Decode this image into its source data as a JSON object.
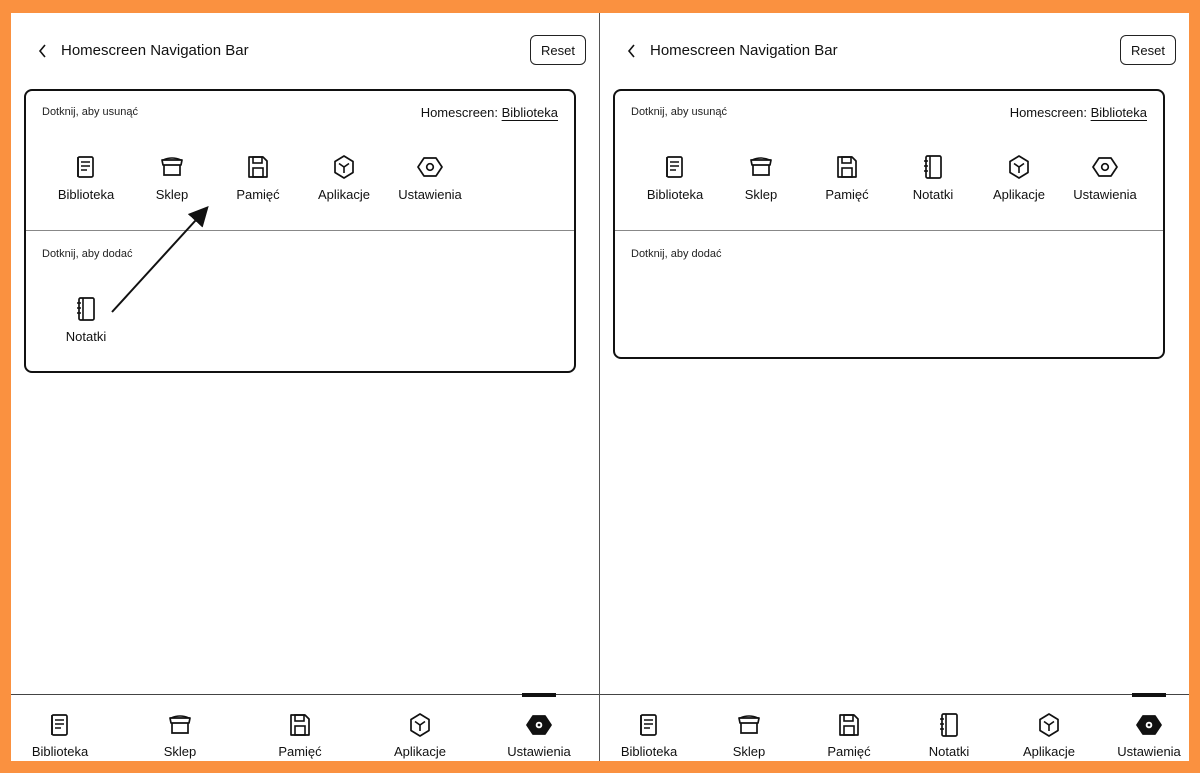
{
  "left": {
    "header": {
      "title": "Homescreen Navigation Bar",
      "reset_label": "Reset"
    },
    "card": {
      "remove_label": "Dotknij, aby usunąć",
      "homescreen_prefix": "Homescreen:",
      "homescreen_value": "Biblioteka",
      "active_items": [
        {
          "label": "Biblioteka",
          "icon": "book-icon"
        },
        {
          "label": "Sklep",
          "icon": "store-icon"
        },
        {
          "label": "Pamięć",
          "icon": "save-icon"
        },
        {
          "label": "Aplikacje",
          "icon": "cube-icon"
        },
        {
          "label": "Ustawienia",
          "icon": "settings-icon"
        }
      ],
      "add_label": "Dotknij, aby dodać",
      "available_items": [
        {
          "label": "Notatki",
          "icon": "notebook-icon"
        }
      ]
    },
    "tabs": [
      {
        "label": "Biblioteka",
        "icon": "book-icon"
      },
      {
        "label": "Sklep",
        "icon": "store-icon"
      },
      {
        "label": "Pamięć",
        "icon": "save-icon"
      },
      {
        "label": "Aplikacje",
        "icon": "cube-icon"
      },
      {
        "label": "Ustawienia",
        "icon": "settings-icon",
        "active": true
      }
    ]
  },
  "right": {
    "header": {
      "title": "Homescreen Navigation Bar",
      "reset_label": "Reset"
    },
    "card": {
      "remove_label": "Dotknij, aby usunąć",
      "homescreen_prefix": "Homescreen:",
      "homescreen_value": "Biblioteka",
      "active_items": [
        {
          "label": "Biblioteka",
          "icon": "book-icon"
        },
        {
          "label": "Sklep",
          "icon": "store-icon"
        },
        {
          "label": "Pamięć",
          "icon": "save-icon"
        },
        {
          "label": "Notatki",
          "icon": "notebook-icon"
        },
        {
          "label": "Aplikacje",
          "icon": "cube-icon"
        },
        {
          "label": "Ustawienia",
          "icon": "settings-icon"
        }
      ],
      "add_label": "Dotknij, aby dodać"
    },
    "tabs": [
      {
        "label": "Biblioteka",
        "icon": "book-icon"
      },
      {
        "label": "Sklep",
        "icon": "store-icon"
      },
      {
        "label": "Pamięć",
        "icon": "save-icon"
      },
      {
        "label": "Notatki",
        "icon": "notebook-icon"
      },
      {
        "label": "Aplikacje",
        "icon": "cube-icon"
      },
      {
        "label": "Ustawienia",
        "icon": "settings-icon",
        "active": true
      }
    ]
  },
  "colors": {
    "frame": "#fa9140",
    "ink": "#111111",
    "background": "#ffffff"
  }
}
